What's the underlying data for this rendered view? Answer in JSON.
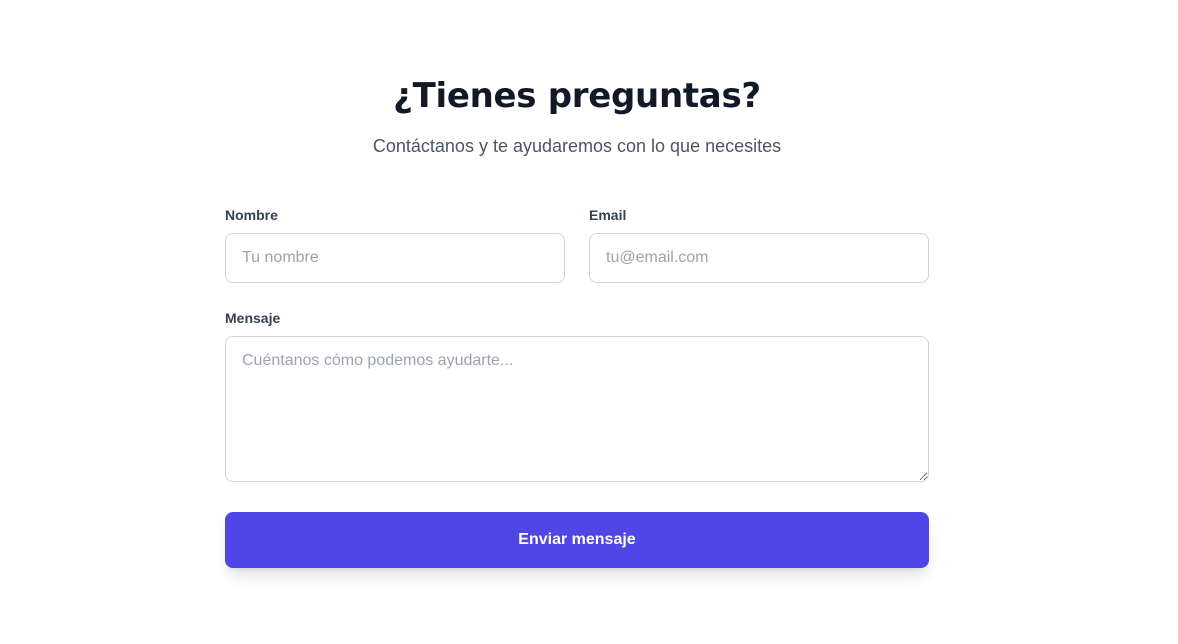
{
  "header": {
    "title": "¿Tienes preguntas?",
    "subtitle": "Contáctanos y te ayudaremos con lo que necesites"
  },
  "form": {
    "name": {
      "label": "Nombre",
      "value": "",
      "placeholder": "Tu nombre"
    },
    "email": {
      "label": "Email",
      "value": "",
      "placeholder": "tu@email.com"
    },
    "message": {
      "label": "Mensaje",
      "value": "",
      "placeholder": "Cuéntanos cómo podemos ayudarte..."
    },
    "submit_label": "Enviar mensaje"
  },
  "colors": {
    "accent": "#4f46e5",
    "title_text": "#111827",
    "subtitle_text": "#4b5563",
    "label_text": "#374151",
    "input_border": "#d1d5db",
    "placeholder_text": "#9ca3af"
  }
}
